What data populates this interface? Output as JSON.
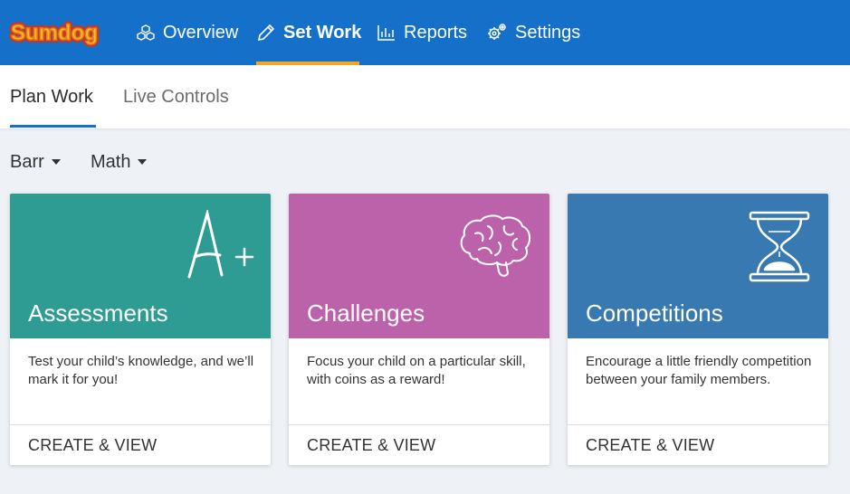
{
  "brand": {
    "name": "SUMDOG",
    "colors": {
      "nav": "#1470c8",
      "accent": "#f5a623"
    }
  },
  "nav": {
    "items": [
      {
        "label": "Overview",
        "icon": "cubes-icon"
      },
      {
        "label": "Set Work",
        "icon": "pencil-icon",
        "active": true
      },
      {
        "label": "Reports",
        "icon": "bar-chart-icon"
      },
      {
        "label": "Settings",
        "icon": "gears-icon"
      }
    ]
  },
  "subtabs": [
    {
      "label": "Plan Work",
      "active": true
    },
    {
      "label": "Live Controls"
    }
  ],
  "filters": {
    "class": "Barr",
    "subject": "Math"
  },
  "cards": [
    {
      "title": "Assessments",
      "description": "Test your child’s knowledge, and we’ll mark it for you!",
      "action": "CREATE & VIEW",
      "color": "#2e9c93",
      "icon": "a-plus-icon"
    },
    {
      "title": "Challenges",
      "description": "Focus your child on a particular skill, with coins as a reward!",
      "action": "CREATE & VIEW",
      "color": "#bb62ab",
      "icon": "brain-icon"
    },
    {
      "title": "Competitions",
      "description": "Encourage a little friendly competition between your family members.",
      "action": "CREATE & VIEW",
      "color": "#3779b0",
      "icon": "hourglass-icon"
    }
  ]
}
